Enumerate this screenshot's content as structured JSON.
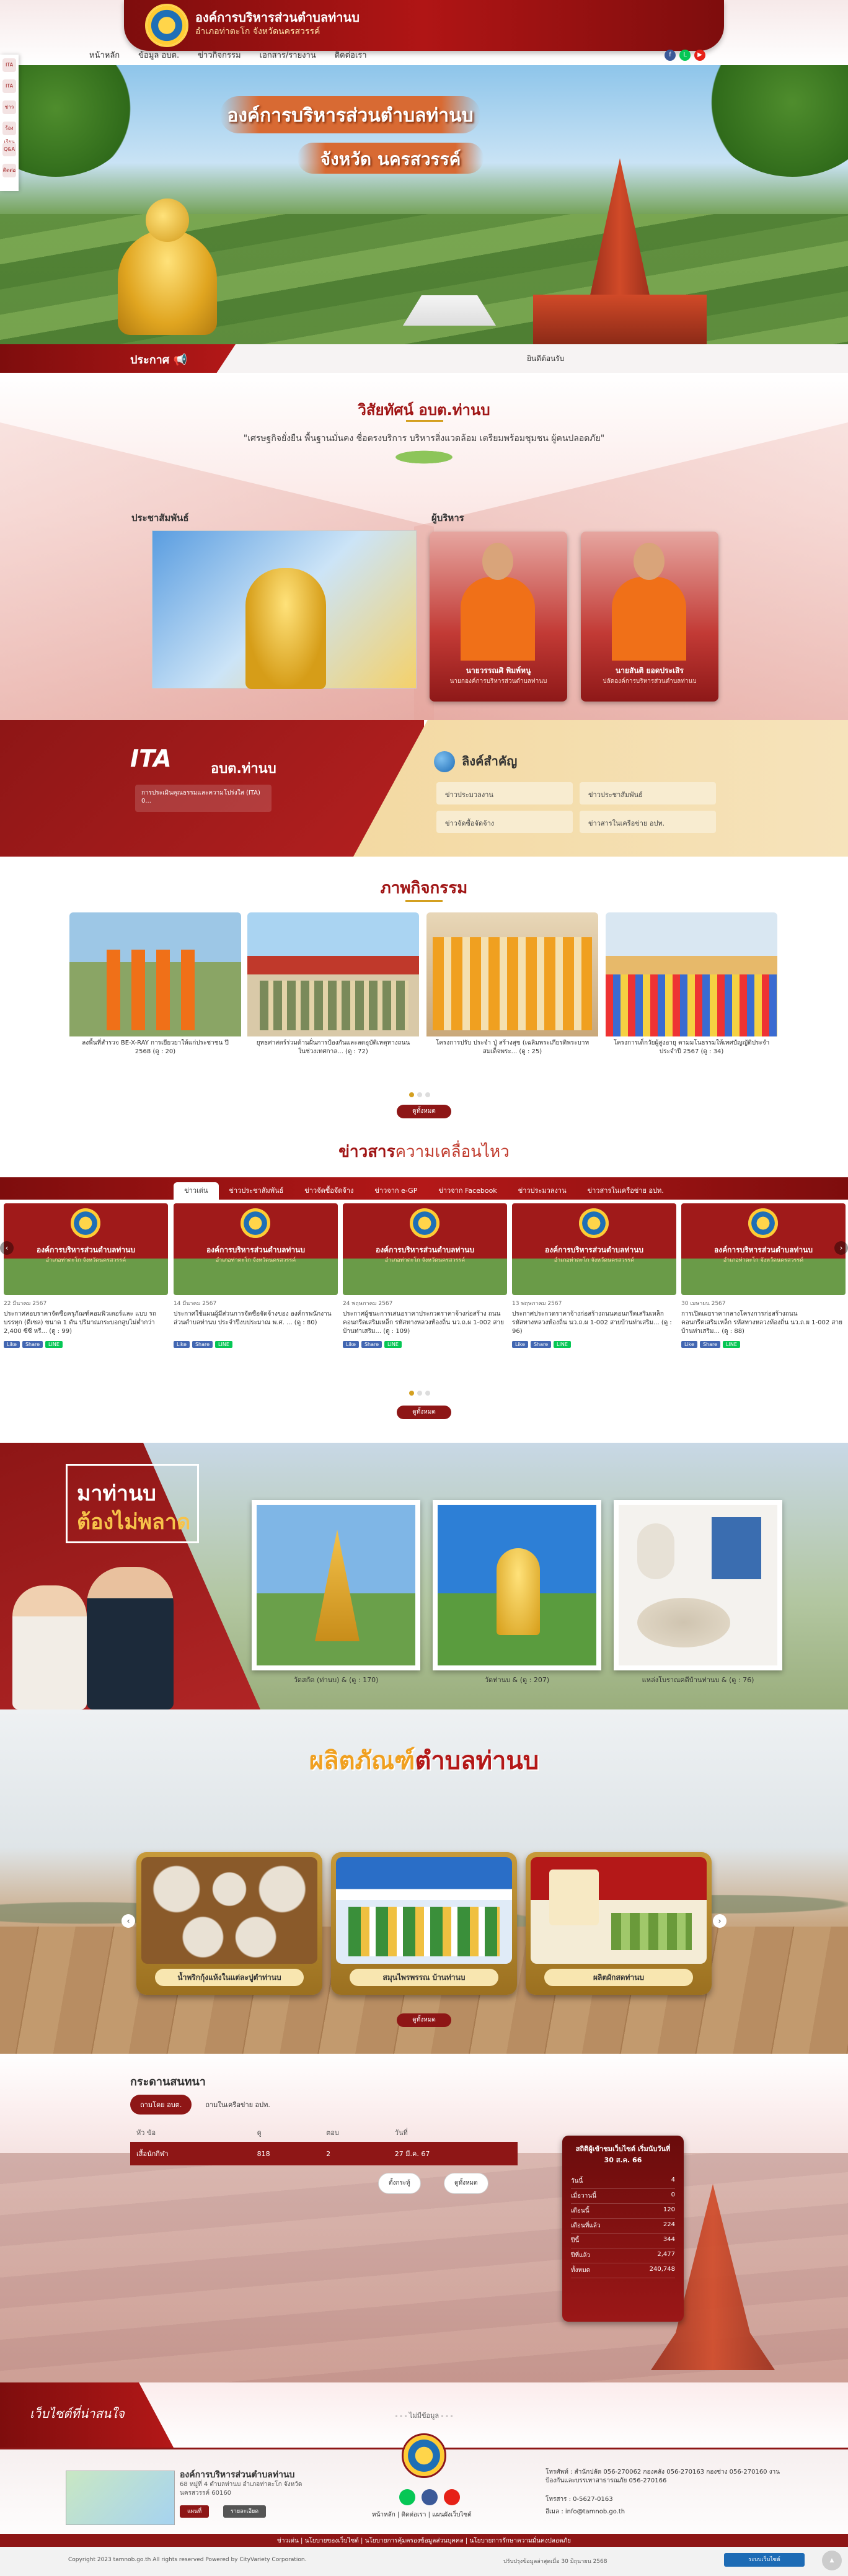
{
  "header": {
    "title": "องค์การบริหารส่วนตำบลท่านบ",
    "subtitle": "อำเภอท่าตะโก จังหวัดนครสวรรค์",
    "nav": [
      "หน้าหลัก",
      "ข้อมูล อบต.",
      "ข่าวกิจกรรม",
      "เอกสาร/รายงาน",
      "ติดต่อเรา"
    ],
    "social_icons": [
      "facebook-icon",
      "line-icon",
      "youtube-icon"
    ]
  },
  "side_rail": [
    "ITA",
    "ITA",
    "ข่าว",
    "ร้องเรียน",
    "Q&A",
    "ติดต่อ"
  ],
  "hero": {
    "title": "องค์การบริหารส่วนตำบลท่านบ",
    "subtitle": "จังหวัด นครสวรรค์"
  },
  "announcement": {
    "label": "ประกาศ",
    "text": "ยินดีต้อนรับ"
  },
  "vision": {
    "title": "วิสัยทัศน์ อบต.ท่านบ",
    "text": "\"เศรษฐกิจยั่งยืน พื้นฐานมั่นคง ชื่อตรงบริการ บริหารสิ่งแวดล้อม เตรียมพร้อมชุมชน ผู้คนปลอดภัย\"",
    "pr_label": "ประชาสัมพันธ์",
    "exec_label": "ผู้บริหาร",
    "executives": [
      {
        "name": "นายวรรณศิ พิมพ์หนู",
        "position": "นายกองค์การบริหารส่วนตำบลท่านบ"
      },
      {
        "name": "นายสันติ ยอดประเสิร",
        "position": "ปลัดองค์การบริหารส่วนตำบลท่านบ"
      }
    ]
  },
  "ita": {
    "logo": "ITA",
    "org": "อบต.ท่านบ",
    "box_text": "การประเมินคุณธรรมและความโปร่งใส (ITA) 0...",
    "links_title": "ลิงค์สำคัญ",
    "links": [
      "ข่าวประมวลงาน",
      "ข่าวประชาสัมพันธ์",
      "ข่าวจัดซื้อจัดจ้าง",
      "ข่าวสารในเครือข่าย อปท."
    ]
  },
  "activities": {
    "title_main": "ภาพกิจกรรม",
    "items": [
      "ลงพื้นที่สำรวจ BE-X-RAY การเยียวยาให้แก่ประชาชน ปี 2568 (ดู : 20)",
      "ยุทธศาสตร์ร่วมด้านฝั่นการป้องกันและลดอุบัติเหตุทางถนน ในช่วงเทศกาล... (ดู : 72)",
      "โครงการปรับ ประจำ ปู่ สร้างสุข (เฉลิมพระเกียรติพระบาทสมเด็จพระ... (ดู : 25)",
      "โครงการเด็กวัยผู้สูงอายุ ตามมโนธรรมให้เทศบัญญัติประจำ ประจำปี 2567 (ดู : 34)"
    ],
    "more": "ดูทั้งหมด"
  },
  "news": {
    "title_main": "ข่าวสาร",
    "title_accent": "ความเคลื่อนไหว",
    "tabs": [
      "ข่าวเด่น",
      "ข่าวประชาสัมพันธ์",
      "ข่าวจัดซื้อจัดจ้าง",
      "ข่าวจาก e-GP",
      "ข่าวจาก Facebook",
      "ข่าวประมวลงาน",
      "ข่าวสารในเครือข่าย อปท."
    ],
    "card_title": "องค์การบริหารส่วนตำบลท่านบ",
    "card_sub": "อำเภอท่าตะโก จังหวัดนครสวรรค์",
    "items": [
      {
        "date": "22 มีนาคม 2567",
        "text": "ประกาศสอบราคาจัดซื้อครุภัณฑ์คอมพิวเตอร์และ แบบ รถบรรทุก (ดีเซล) ขนาด 1 ตัน ปริมาณกระบอกสูบไม่ต่ำกว่า 2,400 ซีซี หรื... (ดู : 99)"
      },
      {
        "date": "14 มีนาคม 2567",
        "text": "ประกาศใช้แผนผู้มีส่วนการจัดซื้อจัดจ้างของ องค์กรพนักงานส่วนตำบลท่านบ ประจำปีงบประมาณ พ.ศ. ... (ดู : 80)"
      },
      {
        "date": "24 พฤษภาคม 2567",
        "text": "ประกาศผู้ชนะการเสนอราคาประกวดราคาจ้างก่อสร้าง ถนนคอนกรีตเสริมเหล็ก รหัสทางหลวงท้องถิ่น นว.ถ.ผ 1-002 สายบ้านท่าเสริม... (ดู : 109)"
      },
      {
        "date": "13 พฤษภาคม 2567",
        "text": "ประกาศประกวดราคาจ้างก่อสร้างถนนคอนกรีตเสริมเหล็ก รหัสทางหลวงท้องถิ่น นว.ถ.ผ 1-002 สายบ้านท่าเสริม... (ดู : 96)"
      },
      {
        "date": "30 เมษายน 2567",
        "text": "การเปิดเผยราคากลางโครงการก่อสร้างถนนคอนกรีตเสริมเหล็ก รหัสทางหลวงท้องถิ่น นว.ถ.ผ 1-002 สายบ้านท่าเสริม... (ดู : 88)"
      }
    ],
    "more": "ดูทั้งหมด"
  },
  "tourism": {
    "line1": "มาท่านบ",
    "line2": "ต้องไม่พลาด",
    "items": [
      "วัดสกัด (ท่านบ) & (ดู : 170)",
      "วัดท่านบ & (ดู : 207)",
      "แหล่งโบราณคดีบ้านท่านบ & (ดู : 76)"
    ]
  },
  "products": {
    "title_main": "ผลิตภัณฑ์",
    "title_accent": "ตำบลท่านบ",
    "items": [
      "น้ำพริกกุ้งแห้งในแต่ละปูตำท่านบ",
      "สมุนไพรพรรณ บ้านท่านบ",
      "ผลิตผักสดท่านบ"
    ],
    "more": "ดูทั้งหมด"
  },
  "board": {
    "title": "กระดานสนทนา",
    "tabs": [
      "ถามโดย อบต.",
      "ถามในเครือข่าย อปท."
    ],
    "headers": [
      "หัว ข้อ",
      "ดู",
      "ตอบ",
      "วันที่"
    ],
    "row": {
      "topic": "เสื้อนักกีฬา",
      "views": "818",
      "replies": "2",
      "date": "27 มี.ค. 67"
    },
    "btn_all": "ดูทั้งหมด",
    "btn_new": "ตั้งกระทู้"
  },
  "stats": {
    "head": "สถิติผู้เข้าชมเว็บไซต์ เริ่มนับวันที่ 30 ส.ค. 66",
    "rows": [
      {
        "label": "วันนี้",
        "value": "4"
      },
      {
        "label": "เมื่อวานนี้",
        "value": "0"
      },
      {
        "label": "เดือนนี้",
        "value": "120"
      },
      {
        "label": "เดือนที่แล้ว",
        "value": "224"
      },
      {
        "label": "ปีนี้",
        "value": "344"
      },
      {
        "label": "ปีที่แล้ว",
        "value": "2,477"
      },
      {
        "label": "ทั้งหมด",
        "value": "240,748"
      }
    ]
  },
  "friends": {
    "label": "เว็บไซต์ที่น่าสนใจ",
    "message": "- - - ไม่มีข้อมูล - - -"
  },
  "footer": {
    "name": "องค์การบริหารส่วนตำบลท่านบ",
    "address": "68 หมู่ที่ 4 ตำบลท่านบ อำเภอท่าตะโก จังหวัดนครสวรรค์ 60160",
    "btn_map": "แผนที่",
    "btn_detail": "รายละเอียด",
    "links": "หน้าหลัก  |  ติดต่อเรา  |  แผนผังเว็บไซต์",
    "phone": "โทรศัพท์ : สำนักปลัด 056-270062 กองคลัง 056-270163 กองช่าง 056-270160 งานป้องกันและบรรเทาสาธารณภัย 056-270166",
    "fax": "โทรสาร : 0-5627-0163",
    "email": "อีเมล : info@tamnob.go.th",
    "menu": "ข่าวเด่น  |  นโยบายของเว็บไซต์  |  นโยบายการคุ้มครองข้อมูลส่วนบุคคล  |  นโยบายการรักษาความมั่นคงปลอดภัย"
  },
  "copyright": {
    "text": "Copyright 2023 tamnob.go.th All rights reserved Powered by CityVariety Corporation.",
    "updated": "ปรับปรุงข้อมูลล่าสุดเมื่อ 30 มิถุนายน 2568",
    "badge": "ระบบเว็บไซต์"
  },
  "colors": {
    "brand": "#8e1616",
    "accent": "#d4a020"
  }
}
